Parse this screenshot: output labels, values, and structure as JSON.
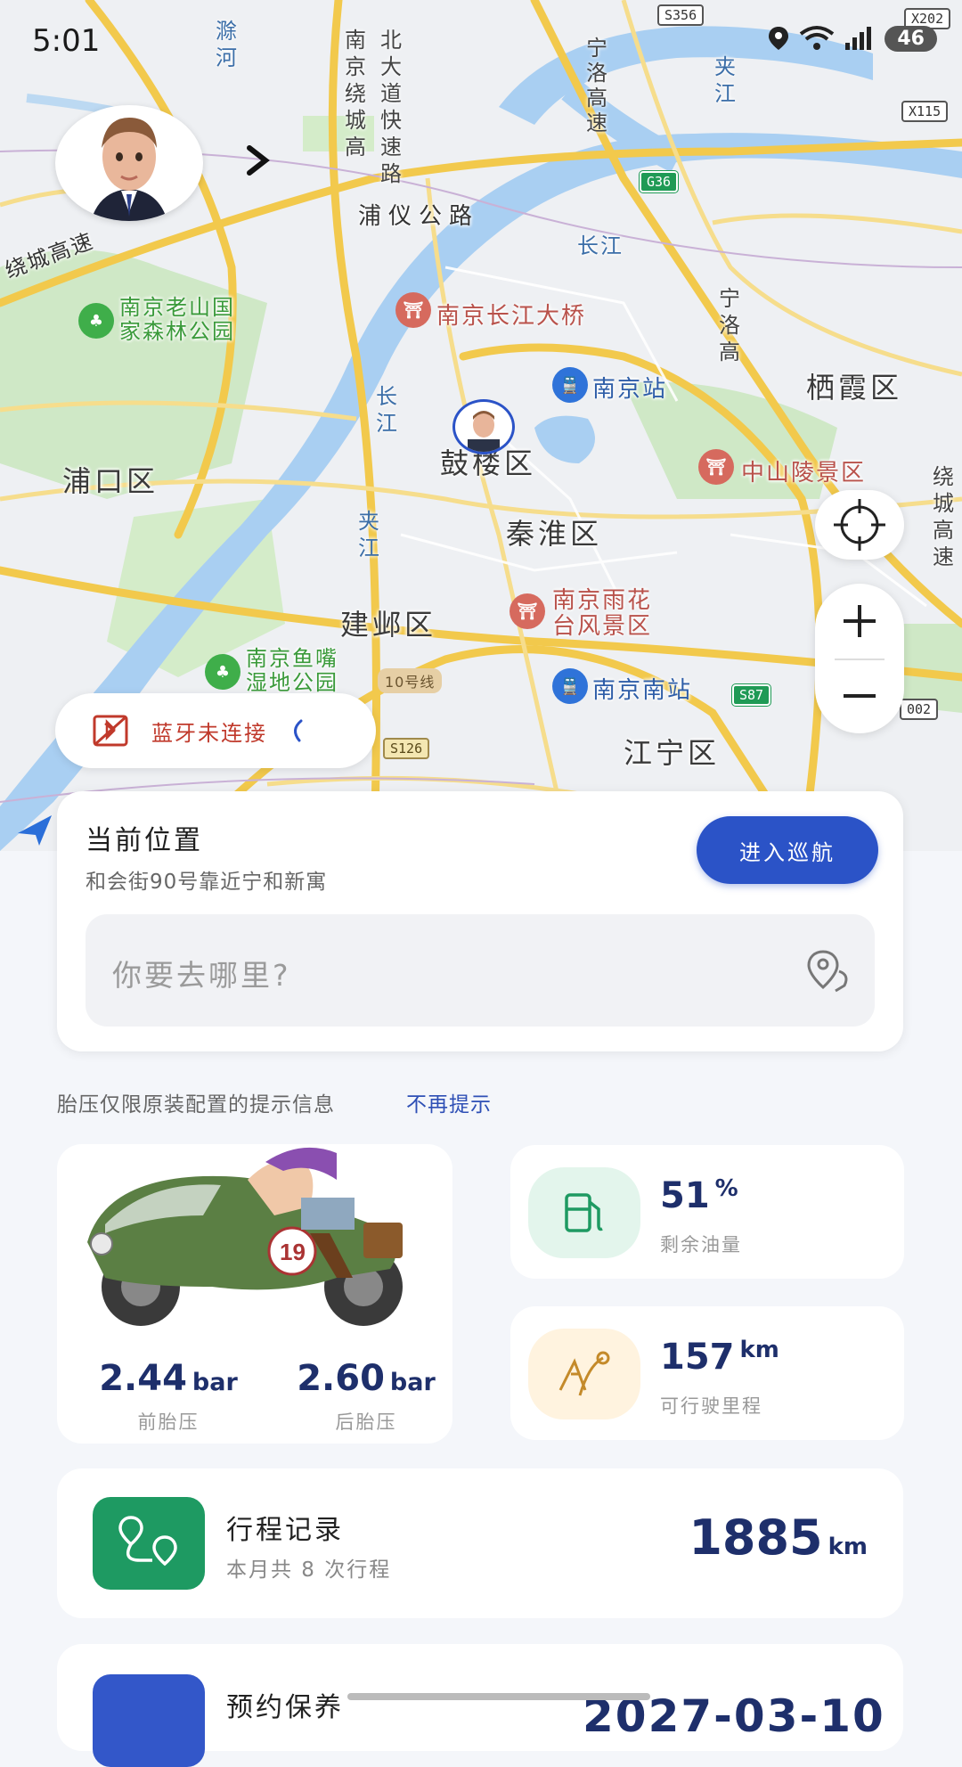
{
  "status_bar": {
    "time": "5:01",
    "battery": "46"
  },
  "map": {
    "districts": [
      "栖霞区",
      "浦口区",
      "鼓楼区",
      "秦淮区",
      "建邺区",
      "江宁区"
    ],
    "pois": {
      "forest_park": "南京老山国\n家森林公园",
      "bridge": "南京长江大桥",
      "station": "南京站",
      "sun_yat_sen": "中山陵景区",
      "yuhuatai": "南京雨花\n台风景区",
      "yuzui": "南京鱼嘴\n湿地公园",
      "south_station": "南京南站"
    },
    "roads": {
      "puyi": "浦仪公路",
      "changjiang": "长江",
      "ring": "绕城高速",
      "metro10": "10号线",
      "ninghe": "宁洛高速",
      "jiahe": "夹江",
      "chuhe": "滁河",
      "north_ave": "南京绕城高速",
      "bei_ave": "北大道快速路"
    },
    "shields": {
      "s356": "S356",
      "x202": "X202",
      "x115": "X115",
      "g36": "G36",
      "s87": "S87",
      "s126": "S126",
      "s002": "002"
    }
  },
  "bluetooth": {
    "label": "蓝牙未连接"
  },
  "location_card": {
    "title": "当前位置",
    "address": "和会街90号靠近宁和新寓",
    "cruise_button": "进入巡航",
    "search_placeholder": "你要去哪里?"
  },
  "tip": {
    "text": "胎压仅限原装配置的提示信息",
    "dismiss": "不再提示"
  },
  "tires": {
    "front": {
      "value": "2.44",
      "unit": "bar",
      "label": "前胎压"
    },
    "rear": {
      "value": "2.60",
      "unit": "bar",
      "label": "后胎压"
    }
  },
  "fuel": {
    "value": "51",
    "unit": "%",
    "label": "剩余油量"
  },
  "range": {
    "value": "157",
    "unit": "km",
    "label": "可行驶里程"
  },
  "trip": {
    "title": "行程记录",
    "subtitle": "本月共 8 次行程",
    "value": "1885",
    "unit": "km"
  },
  "maintenance": {
    "title": "预约保养",
    "date": "2027-03-10"
  },
  "colors": {
    "primary": "#2b53c7",
    "navy": "#1e2f6b",
    "green": "#1e9a62",
    "alert": "#c0392b"
  }
}
